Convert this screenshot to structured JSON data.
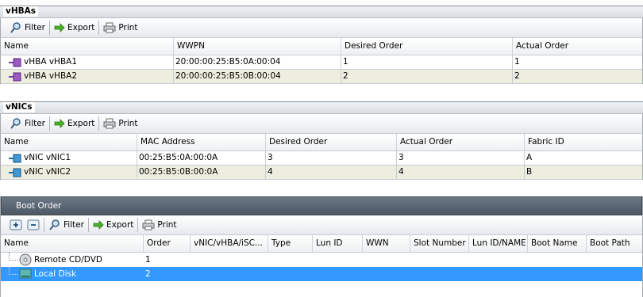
{
  "vhbas": {
    "title": "vHBAs",
    "toolbar": {
      "filter": "Filter",
      "export": "Export",
      "print": "Print"
    },
    "columns": [
      "Name",
      "WWPN",
      "Desired Order",
      "Actual Order"
    ],
    "rows": [
      {
        "name": "vHBA vHBA1",
        "wwpn": "20:00:00:25:B5:0A:00:04",
        "desired": "1",
        "actual": "1"
      },
      {
        "name": "vHBA vHBA2",
        "wwpn": "20:00:00:25:B5:0B:00:04",
        "desired": "2",
        "actual": "2"
      }
    ]
  },
  "vnics": {
    "title": "vNICs",
    "toolbar": {
      "filter": "Filter",
      "export": "Export",
      "print": "Print"
    },
    "columns": [
      "Name",
      "MAC Address",
      "Desired Order",
      "Actual Order",
      "Fabric ID"
    ],
    "rows": [
      {
        "name": "vNIC vNIC1",
        "mac": "00:25:B5:0A:00:0A",
        "desired": "3",
        "actual": "3",
        "fabric": "A"
      },
      {
        "name": "vNIC vNIC2",
        "mac": "00:25:B5:0B:00:0A",
        "desired": "4",
        "actual": "4",
        "fabric": "B"
      }
    ]
  },
  "boot_order": {
    "title": "Boot Order",
    "toolbar": {
      "add": "+",
      "remove": "−",
      "filter": "Filter",
      "export": "Export",
      "print": "Print"
    },
    "columns": [
      "Name",
      "Order",
      "vNIC/vHBA/iSC...",
      "Type",
      "Lun ID",
      "WWN",
      "Slot Number",
      "Lun ID/NAME",
      "Boot Name",
      "Boot Path"
    ],
    "rows": [
      {
        "name": "Remote CD/DVD",
        "order": "1",
        "selected": false,
        "icon": "cd-dvd-icon"
      },
      {
        "name": "Local Disk",
        "order": "2",
        "selected": true,
        "icon": "disk-icon"
      }
    ]
  }
}
